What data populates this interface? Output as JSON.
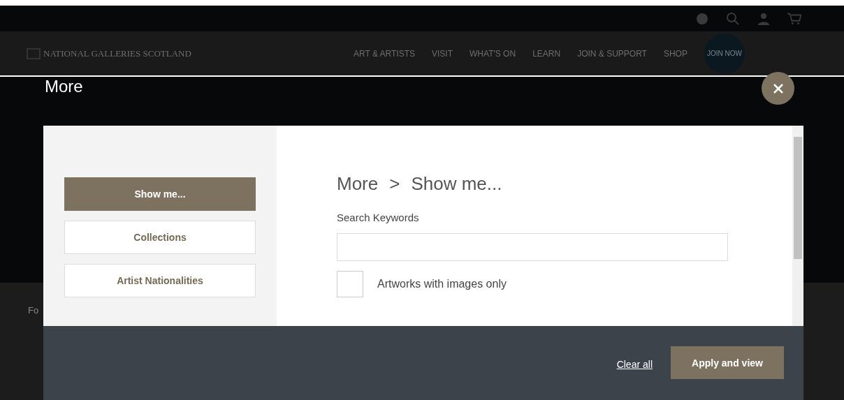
{
  "site": {
    "logo": "NATIONAL GALLERIES SCOTLAND",
    "nav": [
      "ART & ARTISTS",
      "VISIT",
      "WHAT'S ON",
      "LEARN",
      "JOIN & SUPPORT",
      "SHOP"
    ],
    "join": "JOIN NOW",
    "background_text": "Fo"
  },
  "overlay": {
    "title": "More"
  },
  "sidebar": {
    "items": [
      {
        "label": "Show me...",
        "selected": true
      },
      {
        "label": "Collections",
        "selected": false
      },
      {
        "label": "Artist Nationalities",
        "selected": false
      }
    ]
  },
  "panel": {
    "breadcrumb": [
      "More",
      "Show me..."
    ],
    "separator": ">",
    "keywords_label": "Search Keywords",
    "checkbox": {
      "label": "Artworks with images only",
      "checked": false
    }
  },
  "footer": {
    "clear": "Clear all",
    "apply": "Apply and view"
  }
}
